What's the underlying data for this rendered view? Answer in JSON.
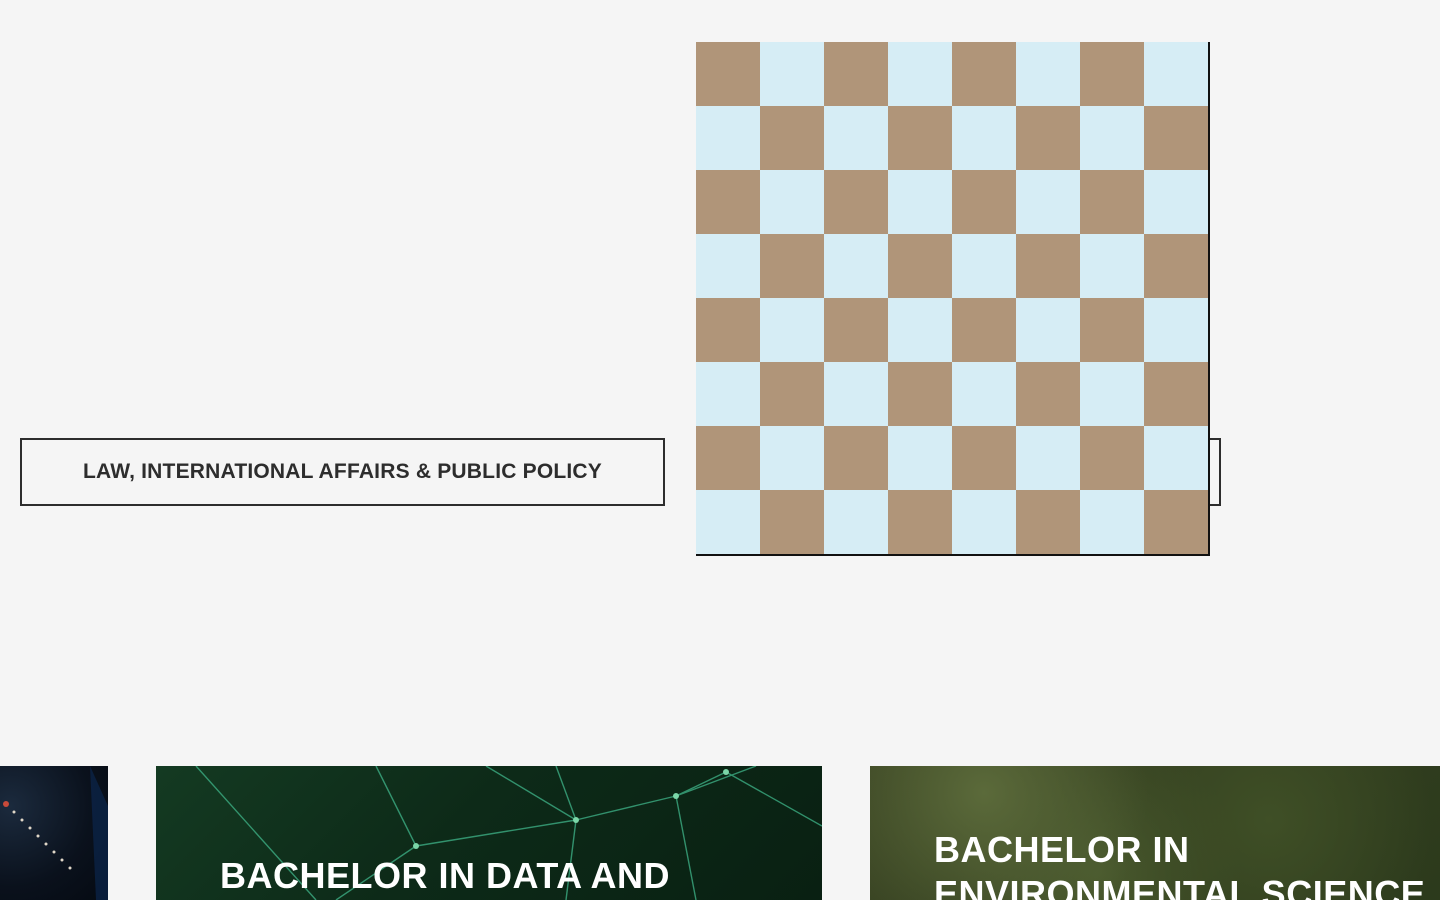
{
  "filters": {
    "law_label": "LAW, INTERNATIONAL AFFAIRS & PUBLIC POLICY"
  },
  "programs": [
    {
      "title_line1": "BACHELOR IN DATA AND",
      "title_line2": ""
    },
    {
      "title_line1": "BACHELOR IN",
      "title_line2": "ENVIRONMENTAL SCIENCE"
    }
  ],
  "colors": {
    "background": "#f5f5f5",
    "button_border": "#2d2d2d",
    "checker_light": "#d6edf5",
    "checker_dark": "#b09579"
  },
  "icons": {
    "placeholder": "checkerboard-image-placeholder"
  }
}
